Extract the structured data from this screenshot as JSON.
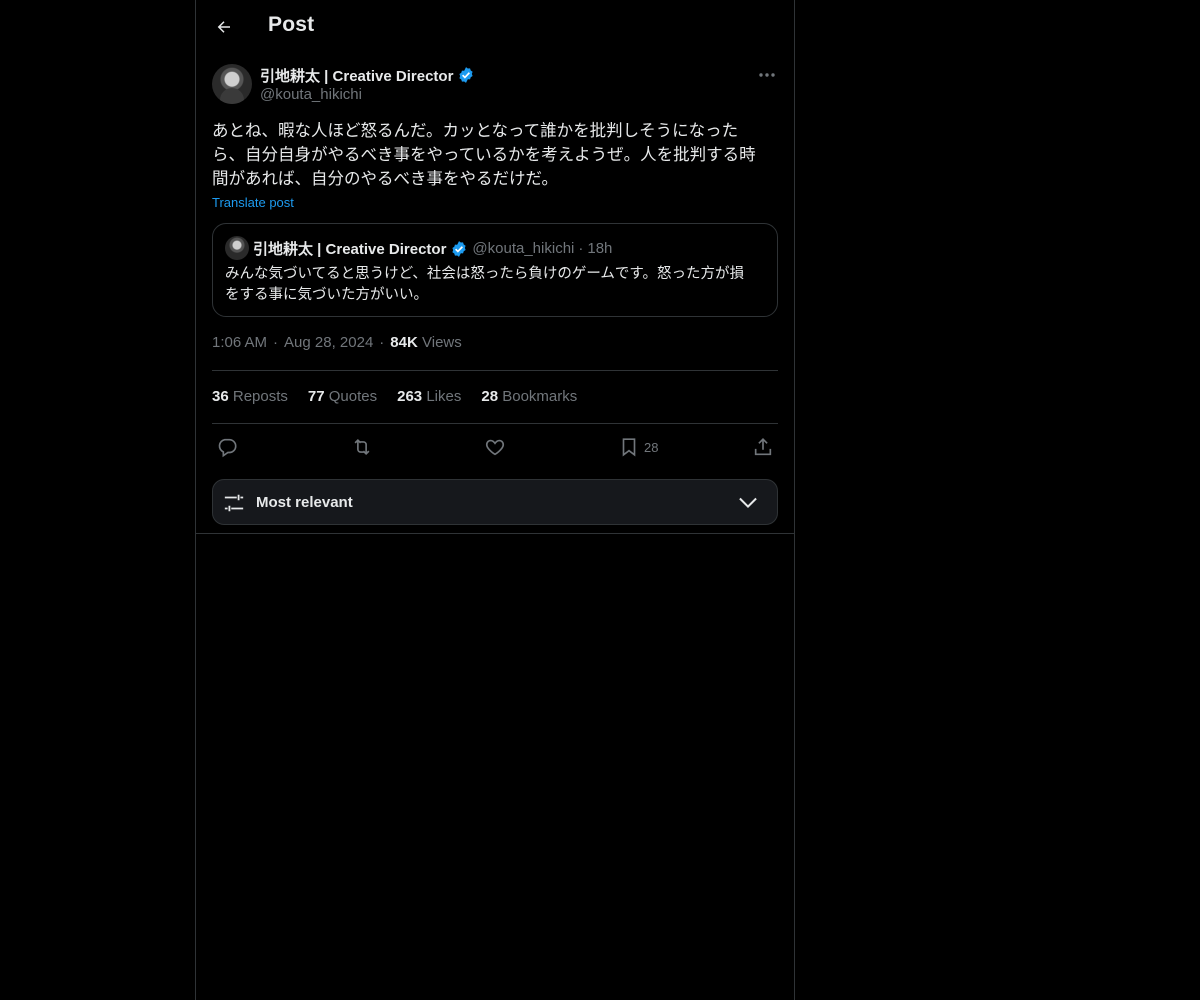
{
  "header": {
    "title": "Post"
  },
  "post": {
    "author_name": "引地耕太 | Creative Director",
    "author_handle": "@kouta_hikichi",
    "text": "あとね、暇な人ほど怒るんだ。カッとなって誰かを批判しそうになった\nら、自分自身がやるべき事をやっているかを考えようぜ。人を批判する時\n間があれば、自分のやるべき事をやるだけだ。",
    "translate_label": "Translate post",
    "quote": {
      "author_name": "引地耕太 | Creative Director",
      "author_handle": "@kouta_hikichi",
      "separator": "·",
      "time": "18h",
      "text": "みんな気づいてると思うけど、社会は怒ったら負けのゲームです。怒った方が損\nをする事に気づいた方がいい。"
    },
    "time": "1:06 AM",
    "date": "Aug 28, 2024",
    "separator": "·",
    "views_count": "84K",
    "views_label": "Views"
  },
  "stats": {
    "reposts_count": "36",
    "reposts_label": "Reposts",
    "quotes_count": "77",
    "quotes_label": "Quotes",
    "likes_count": "263",
    "likes_label": "Likes",
    "bookmarks_count": "28",
    "bookmarks_label": "Bookmarks"
  },
  "actions": {
    "reply_icon": "reply-icon",
    "repost_icon": "repost-icon",
    "like_icon": "heart-icon",
    "bookmark_icon": "bookmark-icon",
    "bookmark_count": "28",
    "share_icon": "share-icon"
  },
  "sort": {
    "label": "Most relevant"
  },
  "colors": {
    "background": "#000000",
    "border": "#2f3336",
    "text": "#e7e9ea",
    "muted": "#71767b",
    "accent": "#1d9bf0"
  }
}
